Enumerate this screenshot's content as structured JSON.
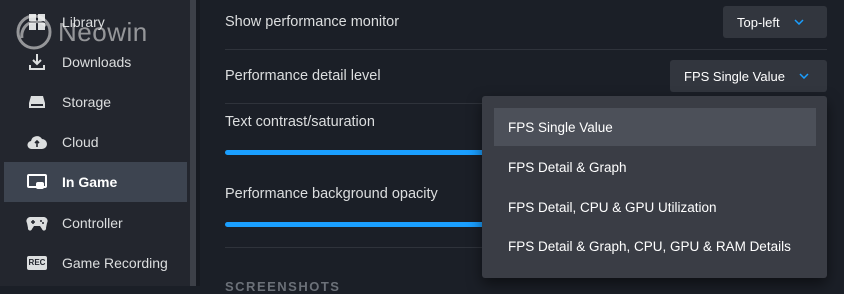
{
  "sidebar": {
    "items": [
      {
        "label": "Library",
        "icon": "library-icon"
      },
      {
        "label": "Downloads",
        "icon": "download-icon"
      },
      {
        "label": "Storage",
        "icon": "storage-icon"
      },
      {
        "label": "Cloud",
        "icon": "cloud-icon"
      },
      {
        "label": "In Game",
        "icon": "in-game-icon",
        "active": true
      },
      {
        "label": "Controller",
        "icon": "controller-icon"
      },
      {
        "label": "Game Recording",
        "icon": "rec-icon",
        "badge": "REC"
      }
    ]
  },
  "watermark": {
    "text": "Neowin"
  },
  "settings": {
    "perf_monitor": {
      "label": "Show performance monitor",
      "value": "Top-left"
    },
    "perf_detail": {
      "label": "Performance detail level",
      "value": "FPS Single Value"
    },
    "text_contrast": {
      "label": "Text contrast/saturation"
    },
    "bg_opacity": {
      "label": "Performance background opacity"
    },
    "next_section": {
      "label": "SCREENSHOTS"
    }
  },
  "menu": {
    "options": [
      {
        "label": "FPS Single Value",
        "selected": true
      },
      {
        "label": "FPS Detail & Graph"
      },
      {
        "label": "FPS Detail, CPU & GPU Utilization"
      },
      {
        "label": "FPS Detail & Graph, CPU, GPU & RAM Details"
      }
    ]
  },
  "colors": {
    "accent": "#1a9fff",
    "background": "#1b1f27",
    "sidebar": "#23262e",
    "active_item": "#3d4450",
    "menu": "#3a3d45"
  }
}
